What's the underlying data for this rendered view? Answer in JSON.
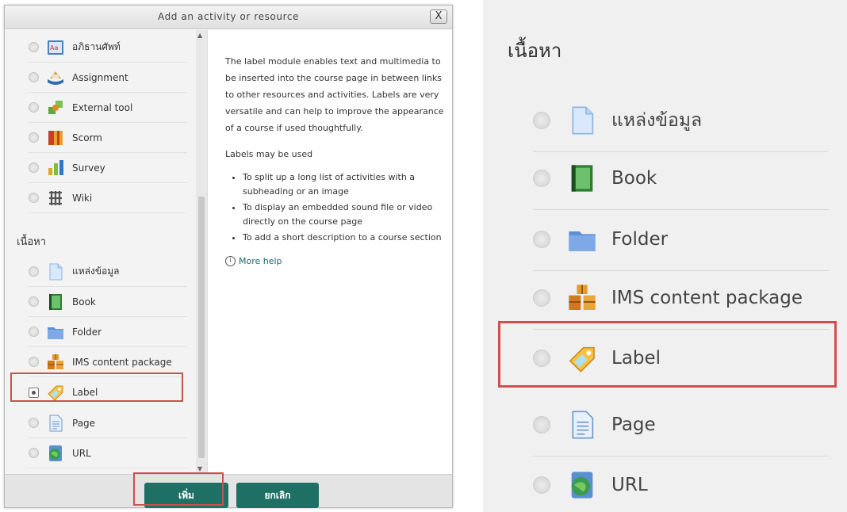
{
  "dialog": {
    "title": "Add an activity or resource",
    "close": "X",
    "activities": [
      {
        "label": "อภิธานศัพท์",
        "icon": "glossary-icon"
      },
      {
        "label": "Assignment",
        "icon": "assignment-icon"
      },
      {
        "label": "External tool",
        "icon": "external-tool-icon"
      },
      {
        "label": "Scorm",
        "icon": "scorm-icon"
      },
      {
        "label": "Survey",
        "icon": "survey-icon"
      },
      {
        "label": "Wiki",
        "icon": "wiki-icon"
      }
    ],
    "resources_heading": "เนื้อหา",
    "resources": [
      {
        "label": "แหล่งข้อมูล",
        "icon": "file-icon"
      },
      {
        "label": "Book",
        "icon": "book-icon"
      },
      {
        "label": "Folder",
        "icon": "folder-icon"
      },
      {
        "label": "IMS content package",
        "icon": "ims-package-icon"
      },
      {
        "label": "Label",
        "icon": "label-icon",
        "selected": true
      },
      {
        "label": "Page",
        "icon": "page-icon"
      },
      {
        "label": "URL",
        "icon": "url-icon"
      }
    ],
    "help": {
      "para1": "The label module enables text and multimedia to be inserted into the course page in between links to other resources and activities. Labels are very versatile and can help to improve the appearance of a course if used thoughtfully.",
      "para2": "Labels may be used",
      "bullets": [
        "To split up a long list of activities with a subheading or an image",
        "To display an embedded sound file or video directly on the course page",
        "To add a short description to a course section"
      ],
      "more_help": "More help"
    },
    "buttons": {
      "add": "เพิ่ม",
      "cancel": "ยกเลิก"
    }
  },
  "zoom": {
    "heading": "เนื้อหา",
    "items": [
      {
        "label": "แหล่งข้อมูล",
        "icon": "file-icon"
      },
      {
        "label": "Book",
        "icon": "book-icon"
      },
      {
        "label": "Folder",
        "icon": "folder-icon"
      },
      {
        "label": "IMS content package",
        "icon": "ims-package-icon"
      },
      {
        "label": "Label",
        "icon": "label-icon"
      },
      {
        "label": "Page",
        "icon": "page-icon"
      },
      {
        "label": "URL",
        "icon": "url-icon"
      }
    ]
  },
  "colors": {
    "accent": "#1e7065",
    "highlight": "#c9524f"
  }
}
